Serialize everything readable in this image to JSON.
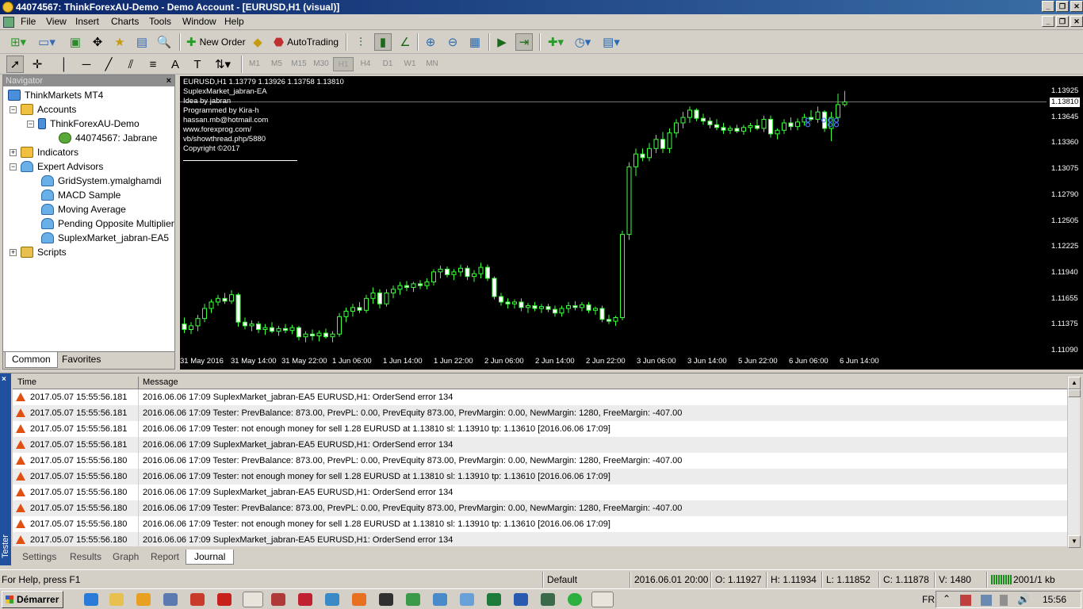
{
  "window": {
    "title": "44074567: ThinkForexAU-Demo - Demo Account - [EURUSD,H1 (visual)]"
  },
  "menu": [
    "File",
    "View",
    "Insert",
    "Charts",
    "Tools",
    "Window",
    "Help"
  ],
  "toolbar": {
    "new_order": "New Order",
    "autotrading": "AutoTrading",
    "search_badge": "5"
  },
  "timeframes": [
    "M1",
    "M5",
    "M15",
    "M30",
    "H1",
    "H4",
    "D1",
    "W1",
    "MN"
  ],
  "navigator": {
    "title": "Navigator",
    "root": "ThinkMarkets MT4",
    "accounts": "Accounts",
    "server": "ThinkForexAU-Demo",
    "account": "44074567: Jabrane",
    "indicators": "Indicators",
    "experts": "Expert Advisors",
    "ea_list": [
      "GridSystem.ymalghamdi",
      "MACD Sample",
      "Moving Average",
      "Pending Opposite Multiplier EA",
      "SuplexMarket_jabran-EA5"
    ],
    "scripts": "Scripts",
    "tabs": [
      "Common",
      "Favorites"
    ]
  },
  "chart": {
    "info": [
      "EURUSD,H1  1.13779 1.13926 1.13758 1.13810",
      "SuplexMarket_jabran-EA",
      "Idea by jabran",
      "Programmed by Kira-h",
      "hassan.mb@hotmail.com",
      "www.forexprog.com/",
      "vb/showthread.php/5880",
      "Copyright ©2017"
    ],
    "price_labels": [
      "1.13925",
      "1.13810",
      "1.13645",
      "1.13360",
      "1.13075",
      "1.12790",
      "1.12505",
      "1.12225",
      "1.11940",
      "1.11655",
      "1.11375",
      "1.11090"
    ],
    "time_labels": [
      "31 May 2016",
      "31 May 14:00",
      "31 May 22:00",
      "1 Jun 06:00",
      "1 Jun 14:00",
      "1 Jun 22:00",
      "2 Jun 06:00",
      "2 Jun 14:00",
      "2 Jun 22:00",
      "3 Jun 06:00",
      "3 Jun 14:00",
      "5 Jun 22:00",
      "6 Jun 06:00",
      "6 Jun 14:00"
    ],
    "colors": {
      "bull": "#3cff3c",
      "bear": "#ffffff",
      "background": "#000000"
    }
  },
  "chart_data": {
    "type": "candlestick",
    "symbol": "EURUSD",
    "timeframe": "H1",
    "current_price": 1.1381,
    "ylim": [
      1.1109,
      1.1404
    ],
    "candles": [
      {
        "o": 1.1138,
        "h": 1.1145,
        "l": 1.1128,
        "c": 1.1132
      },
      {
        "o": 1.1132,
        "h": 1.114,
        "l": 1.1127,
        "c": 1.1136
      },
      {
        "o": 1.1136,
        "h": 1.1148,
        "l": 1.113,
        "c": 1.1144
      },
      {
        "o": 1.1144,
        "h": 1.116,
        "l": 1.114,
        "c": 1.1155
      },
      {
        "o": 1.1155,
        "h": 1.1165,
        "l": 1.115,
        "c": 1.1162
      },
      {
        "o": 1.1162,
        "h": 1.117,
        "l": 1.1158,
        "c": 1.1166
      },
      {
        "o": 1.1166,
        "h": 1.1172,
        "l": 1.116,
        "c": 1.1163
      },
      {
        "o": 1.1163,
        "h": 1.1175,
        "l": 1.116,
        "c": 1.117
      },
      {
        "o": 1.117,
        "h": 1.1172,
        "l": 1.1135,
        "c": 1.114
      },
      {
        "o": 1.114,
        "h": 1.1145,
        "l": 1.1132,
        "c": 1.1136
      },
      {
        "o": 1.1136,
        "h": 1.1142,
        "l": 1.113,
        "c": 1.1138
      },
      {
        "o": 1.1138,
        "h": 1.1141,
        "l": 1.1128,
        "c": 1.1132
      },
      {
        "o": 1.1132,
        "h": 1.1138,
        "l": 1.1126,
        "c": 1.1134
      },
      {
        "o": 1.1134,
        "h": 1.114,
        "l": 1.1128,
        "c": 1.113
      },
      {
        "o": 1.113,
        "h": 1.1136,
        "l": 1.1125,
        "c": 1.1133
      },
      {
        "o": 1.1133,
        "h": 1.1138,
        "l": 1.1128,
        "c": 1.1131
      },
      {
        "o": 1.1131,
        "h": 1.1137,
        "l": 1.1127,
        "c": 1.1134
      },
      {
        "o": 1.1134,
        "h": 1.1136,
        "l": 1.112,
        "c": 1.1124
      },
      {
        "o": 1.1124,
        "h": 1.113,
        "l": 1.1118,
        "c": 1.1127
      },
      {
        "o": 1.1127,
        "h": 1.1132,
        "l": 1.112,
        "c": 1.1125
      },
      {
        "o": 1.1125,
        "h": 1.1131,
        "l": 1.1119,
        "c": 1.1128
      },
      {
        "o": 1.1128,
        "h": 1.1133,
        "l": 1.1122,
        "c": 1.1124
      },
      {
        "o": 1.1124,
        "h": 1.113,
        "l": 1.1118,
        "c": 1.1127
      },
      {
        "o": 1.1127,
        "h": 1.115,
        "l": 1.1124,
        "c": 1.1146
      },
      {
        "o": 1.1146,
        "h": 1.1156,
        "l": 1.114,
        "c": 1.1152
      },
      {
        "o": 1.1152,
        "h": 1.116,
        "l": 1.1146,
        "c": 1.1156
      },
      {
        "o": 1.1156,
        "h": 1.1162,
        "l": 1.115,
        "c": 1.1153
      },
      {
        "o": 1.1153,
        "h": 1.117,
        "l": 1.115,
        "c": 1.1166
      },
      {
        "o": 1.1166,
        "h": 1.1178,
        "l": 1.116,
        "c": 1.1172
      },
      {
        "o": 1.1172,
        "h": 1.1176,
        "l": 1.1155,
        "c": 1.116
      },
      {
        "o": 1.116,
        "h": 1.1176,
        "l": 1.1157,
        "c": 1.1172
      },
      {
        "o": 1.1172,
        "h": 1.118,
        "l": 1.1166,
        "c": 1.1176
      },
      {
        "o": 1.1176,
        "h": 1.1184,
        "l": 1.117,
        "c": 1.118
      },
      {
        "o": 1.118,
        "h": 1.1185,
        "l": 1.1174,
        "c": 1.1178
      },
      {
        "o": 1.1178,
        "h": 1.1184,
        "l": 1.1173,
        "c": 1.1182
      },
      {
        "o": 1.1182,
        "h": 1.1186,
        "l": 1.1176,
        "c": 1.118
      },
      {
        "o": 1.118,
        "h": 1.1188,
        "l": 1.1176,
        "c": 1.1184
      },
      {
        "o": 1.1184,
        "h": 1.1198,
        "l": 1.118,
        "c": 1.1195
      },
      {
        "o": 1.1195,
        "h": 1.1202,
        "l": 1.1188,
        "c": 1.1198
      },
      {
        "o": 1.1198,
        "h": 1.1201,
        "l": 1.1189,
        "c": 1.1192
      },
      {
        "o": 1.1192,
        "h": 1.1198,
        "l": 1.1186,
        "c": 1.1195
      },
      {
        "o": 1.1195,
        "h": 1.1203,
        "l": 1.119,
        "c": 1.1199
      },
      {
        "o": 1.1199,
        "h": 1.1202,
        "l": 1.1186,
        "c": 1.119
      },
      {
        "o": 1.119,
        "h": 1.1197,
        "l": 1.1184,
        "c": 1.1193
      },
      {
        "o": 1.1193,
        "h": 1.1205,
        "l": 1.1188,
        "c": 1.12
      },
      {
        "o": 1.12,
        "h": 1.1203,
        "l": 1.1185,
        "c": 1.1188
      },
      {
        "o": 1.1188,
        "h": 1.119,
        "l": 1.1165,
        "c": 1.1168
      },
      {
        "o": 1.1168,
        "h": 1.1172,
        "l": 1.1158,
        "c": 1.1162
      },
      {
        "o": 1.1162,
        "h": 1.1166,
        "l": 1.1155,
        "c": 1.116
      },
      {
        "o": 1.116,
        "h": 1.1165,
        "l": 1.1155,
        "c": 1.1162
      },
      {
        "o": 1.1162,
        "h": 1.1166,
        "l": 1.1152,
        "c": 1.1156
      },
      {
        "o": 1.1156,
        "h": 1.1161,
        "l": 1.115,
        "c": 1.1158
      },
      {
        "o": 1.1158,
        "h": 1.1162,
        "l": 1.1152,
        "c": 1.1155
      },
      {
        "o": 1.1155,
        "h": 1.116,
        "l": 1.115,
        "c": 1.1157
      },
      {
        "o": 1.1157,
        "h": 1.116,
        "l": 1.1151,
        "c": 1.1154
      },
      {
        "o": 1.1154,
        "h": 1.1158,
        "l": 1.1146,
        "c": 1.115
      },
      {
        "o": 1.115,
        "h": 1.1158,
        "l": 1.1146,
        "c": 1.1155
      },
      {
        "o": 1.1155,
        "h": 1.1162,
        "l": 1.115,
        "c": 1.1158
      },
      {
        "o": 1.1158,
        "h": 1.1163,
        "l": 1.1153,
        "c": 1.1156
      },
      {
        "o": 1.1156,
        "h": 1.1162,
        "l": 1.1152,
        "c": 1.1159
      },
      {
        "o": 1.1159,
        "h": 1.1162,
        "l": 1.115,
        "c": 1.1153
      },
      {
        "o": 1.1153,
        "h": 1.1157,
        "l": 1.1148,
        "c": 1.1155
      },
      {
        "o": 1.1155,
        "h": 1.1158,
        "l": 1.114,
        "c": 1.1143
      },
      {
        "o": 1.1143,
        "h": 1.1148,
        "l": 1.1138,
        "c": 1.1141
      },
      {
        "o": 1.1141,
        "h": 1.1147,
        "l": 1.1136,
        "c": 1.1145
      },
      {
        "o": 1.1145,
        "h": 1.124,
        "l": 1.1142,
        "c": 1.1236
      },
      {
        "o": 1.1236,
        "h": 1.1315,
        "l": 1.123,
        "c": 1.131
      },
      {
        "o": 1.131,
        "h": 1.133,
        "l": 1.13,
        "c": 1.1324
      },
      {
        "o": 1.1324,
        "h": 1.133,
        "l": 1.1316,
        "c": 1.132
      },
      {
        "o": 1.132,
        "h": 1.1336,
        "l": 1.1316,
        "c": 1.133
      },
      {
        "o": 1.133,
        "h": 1.1345,
        "l": 1.1325,
        "c": 1.134
      },
      {
        "o": 1.134,
        "h": 1.1348,
        "l": 1.1325,
        "c": 1.133
      },
      {
        "o": 1.133,
        "h": 1.1352,
        "l": 1.1325,
        "c": 1.1347
      },
      {
        "o": 1.1347,
        "h": 1.1362,
        "l": 1.1342,
        "c": 1.1358
      },
      {
        "o": 1.1358,
        "h": 1.137,
        "l": 1.1352,
        "c": 1.1364
      },
      {
        "o": 1.1364,
        "h": 1.1376,
        "l": 1.1358,
        "c": 1.1372
      },
      {
        "o": 1.1372,
        "h": 1.1374,
        "l": 1.136,
        "c": 1.1363
      },
      {
        "o": 1.1363,
        "h": 1.1368,
        "l": 1.1356,
        "c": 1.136
      },
      {
        "o": 1.136,
        "h": 1.1364,
        "l": 1.1352,
        "c": 1.1356
      },
      {
        "o": 1.1356,
        "h": 1.1362,
        "l": 1.135,
        "c": 1.1353
      },
      {
        "o": 1.1353,
        "h": 1.1358,
        "l": 1.1346,
        "c": 1.135
      },
      {
        "o": 1.135,
        "h": 1.1355,
        "l": 1.1346,
        "c": 1.1352
      },
      {
        "o": 1.1352,
        "h": 1.1356,
        "l": 1.1347,
        "c": 1.1349
      },
      {
        "o": 1.1349,
        "h": 1.1356,
        "l": 1.1345,
        "c": 1.1353
      },
      {
        "o": 1.1353,
        "h": 1.1358,
        "l": 1.1348,
        "c": 1.1355
      },
      {
        "o": 1.1355,
        "h": 1.1362,
        "l": 1.135,
        "c": 1.1352
      },
      {
        "o": 1.1352,
        "h": 1.1366,
        "l": 1.1348,
        "c": 1.1362
      },
      {
        "o": 1.1362,
        "h": 1.1366,
        "l": 1.1342,
        "c": 1.1346
      },
      {
        "o": 1.1346,
        "h": 1.1352,
        "l": 1.134,
        "c": 1.135
      },
      {
        "o": 1.135,
        "h": 1.1362,
        "l": 1.1346,
        "c": 1.1358
      },
      {
        "o": 1.1358,
        "h": 1.1364,
        "l": 1.135,
        "c": 1.1354
      },
      {
        "o": 1.1354,
        "h": 1.1363,
        "l": 1.135,
        "c": 1.1359
      },
      {
        "o": 1.1359,
        "h": 1.1368,
        "l": 1.1355,
        "c": 1.1364
      },
      {
        "o": 1.1364,
        "h": 1.1372,
        "l": 1.136,
        "c": 1.1362
      },
      {
        "o": 1.1362,
        "h": 1.1376,
        "l": 1.1358,
        "c": 1.137
      },
      {
        "o": 1.137,
        "h": 1.1372,
        "l": 1.1348,
        "c": 1.1352
      },
      {
        "o": 1.1352,
        "h": 1.137,
        "l": 1.1338,
        "c": 1.1364
      },
      {
        "o": 1.1364,
        "h": 1.139,
        "l": 1.136,
        "c": 1.1378
      },
      {
        "o": 1.1378,
        "h": 1.1393,
        "l": 1.1376,
        "c": 1.1381
      }
    ]
  },
  "log": {
    "headers": {
      "time": "Time",
      "message": "Message"
    },
    "rows": [
      {
        "time": "2017.05.07 15:55:56.181",
        "message": "2016.06.06 17:09  SuplexMarket_jabran-EA5 EURUSD,H1: OrderSend error 134"
      },
      {
        "time": "2017.05.07 15:55:56.181",
        "message": "2016.06.06 17:09  Tester: PrevBalance: 873.00, PrevPL: 0.00, PrevEquity 873.00, PrevMargin: 0.00, NewMargin: 1280, FreeMargin: -407.00"
      },
      {
        "time": "2017.05.07 15:55:56.181",
        "message": "2016.06.06 17:09  Tester: not enough money for sell 1.28 EURUSD at 1.13810 sl: 1.13910 tp: 1.13610 [2016.06.06 17:09]"
      },
      {
        "time": "2017.05.07 15:55:56.181",
        "message": "2016.06.06 17:09  SuplexMarket_jabran-EA5 EURUSD,H1: OrderSend error 134"
      },
      {
        "time": "2017.05.07 15:55:56.180",
        "message": "2016.06.06 17:09  Tester: PrevBalance: 873.00, PrevPL: 0.00, PrevEquity 873.00, PrevMargin: 0.00, NewMargin: 1280, FreeMargin: -407.00"
      },
      {
        "time": "2017.05.07 15:55:56.180",
        "message": "2016.06.06 17:09  Tester: not enough money for sell 1.28 EURUSD at 1.13810 sl: 1.13910 tp: 1.13610 [2016.06.06 17:09]"
      },
      {
        "time": "2017.05.07 15:55:56.180",
        "message": "2016.06.06 17:09  SuplexMarket_jabran-EA5 EURUSD,H1: OrderSend error 134"
      },
      {
        "time": "2017.05.07 15:55:56.180",
        "message": "2016.06.06 17:09  Tester: PrevBalance: 873.00, PrevPL: 0.00, PrevEquity 873.00, PrevMargin: 0.00, NewMargin: 1280, FreeMargin: -407.00"
      },
      {
        "time": "2017.05.07 15:55:56.180",
        "message": "2016.06.06 17:09  Tester: not enough money for sell 1.28 EURUSD at 1.13810 sl: 1.13910 tp: 1.13610 [2016.06.06 17:09]"
      },
      {
        "time": "2017.05.07 15:55:56.180",
        "message": "2016.06.06 17:09  SuplexMarket_jabran-EA5 EURUSD,H1: OrderSend error 134"
      }
    ]
  },
  "tester": {
    "side_label": "Tester",
    "close": "×",
    "tabs": [
      "Settings",
      "Results",
      "Graph",
      "Report",
      "Journal"
    ]
  },
  "status": {
    "help": "For Help, press F1",
    "profile": "Default",
    "datetime": "2016.06.01 20:00",
    "open": "O: 1.11927",
    "high": "H: 1.11934",
    "low": "L: 1.11852",
    "close": "C: 1.11878",
    "volume": "V: 1480",
    "traffic": "2001/1 kb"
  },
  "taskbar": {
    "start": "Démarrer",
    "lang": "FR",
    "clock": "15:56"
  }
}
